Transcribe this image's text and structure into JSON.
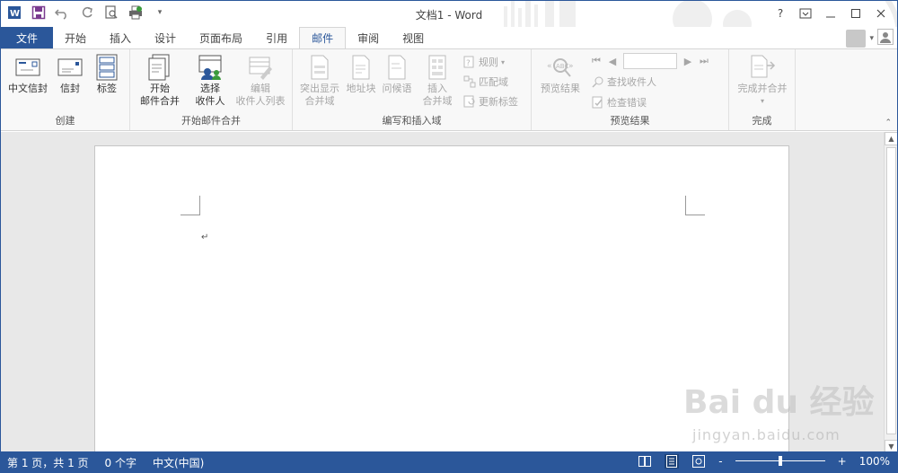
{
  "window": {
    "title": "文档1 - Word",
    "help": "?"
  },
  "tabs": {
    "file": "文件",
    "items": [
      "开始",
      "插入",
      "设计",
      "页面布局",
      "引用",
      "邮件",
      "审阅",
      "视图"
    ],
    "active": "邮件"
  },
  "ribbon": {
    "create": {
      "label": "创建",
      "cn_envelope": "中文信封",
      "envelope": "信封",
      "labels": "标签"
    },
    "start_merge": {
      "label": "开始邮件合并",
      "start_line1": "开始",
      "start_line2": "邮件合并",
      "select_line1": "选择",
      "select_line2": "收件人",
      "edit_line1": "编辑",
      "edit_line2": "收件人列表"
    },
    "write_insert": {
      "label": "编写和插入域",
      "highlight_line1": "突出显示",
      "highlight_line2": "合并域",
      "address_block": "地址块",
      "greeting": "问候语",
      "insert_line1": "插入",
      "insert_line2": "合并域",
      "rules": "规则",
      "match_fields": "匹配域",
      "update_labels": "更新标签"
    },
    "preview": {
      "label": "预览结果",
      "preview_results": "预览结果",
      "find_recipient": "查找收件人",
      "check_errors": "检查错误",
      "record_value": ""
    },
    "finish": {
      "label": "完成",
      "finish_merge": "完成并合并"
    }
  },
  "document": {
    "paragraph_mark": "↵"
  },
  "status": {
    "page": "第 1 页，共 1 页",
    "words": "0 个字",
    "language": "中文(中国)",
    "zoom": "100%",
    "zoom_minus": "-",
    "zoom_plus": "+",
    "zoom_fraction": 0.5
  },
  "watermark": {
    "brand": "Bai du 经验",
    "url": "jingyan.baidu.com"
  },
  "colors": {
    "accent": "#2b579a",
    "disabled": "#a6a6a6"
  }
}
